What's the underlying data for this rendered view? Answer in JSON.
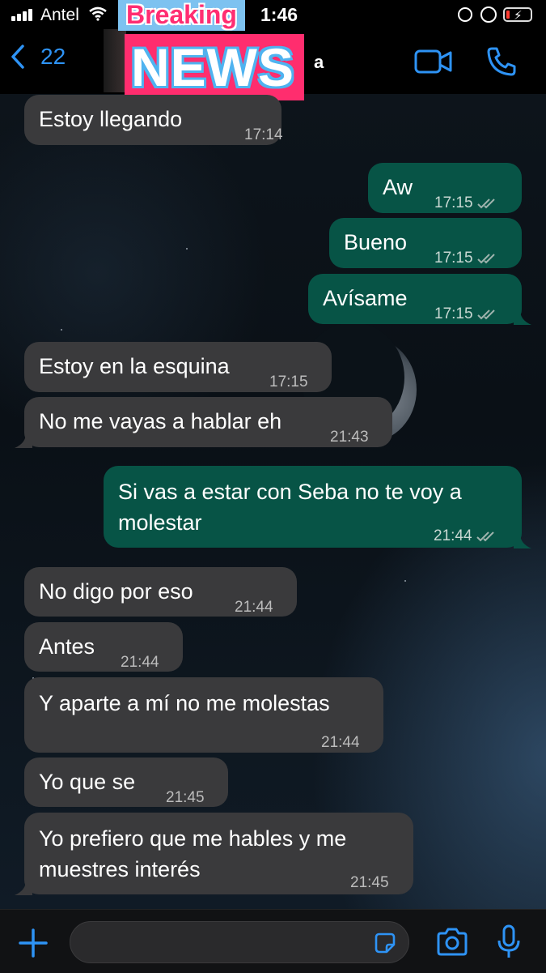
{
  "status_bar": {
    "carrier": "Antel",
    "time": "1:46",
    "battery_level": 0.15
  },
  "header": {
    "back_count": "22",
    "contact_name_visible": "a"
  },
  "overlay": {
    "line1": "Breaking",
    "line2": "NEWS"
  },
  "messages": [
    {
      "dir": "in",
      "text": "Estoy llegando",
      "time": "17:14"
    },
    {
      "dir": "out",
      "text": "Aw",
      "time": "17:15"
    },
    {
      "dir": "out",
      "text": "Bueno",
      "time": "17:15"
    },
    {
      "dir": "out",
      "text": "Avísame",
      "time": "17:15"
    },
    {
      "dir": "in",
      "text": "Estoy en la esquina",
      "time": "17:15"
    },
    {
      "dir": "in",
      "text": "No me vayas a hablar eh",
      "time": "21:43"
    },
    {
      "dir": "out",
      "text": "Si vas a estar con Seba no te voy a molestar",
      "time": "21:44"
    },
    {
      "dir": "in",
      "text": "No digo por eso",
      "time": "21:44"
    },
    {
      "dir": "in",
      "text": "Antes",
      "time": "21:44"
    },
    {
      "dir": "in",
      "text": "Y aparte a mí no me molestas",
      "time": "21:44"
    },
    {
      "dir": "in",
      "text": "Yo que se",
      "time": "21:45"
    },
    {
      "dir": "in",
      "text": "Yo prefiero que me hables y me muestres interés",
      "time": "21:45"
    }
  ],
  "composer": {
    "placeholder": ""
  },
  "colors": {
    "accent": "#2e93f5",
    "incoming_bubble": "#3a3a3c",
    "outgoing_bubble": "#075446",
    "news_pink": "#ff2d6e",
    "news_blue": "#7dc2f0"
  }
}
